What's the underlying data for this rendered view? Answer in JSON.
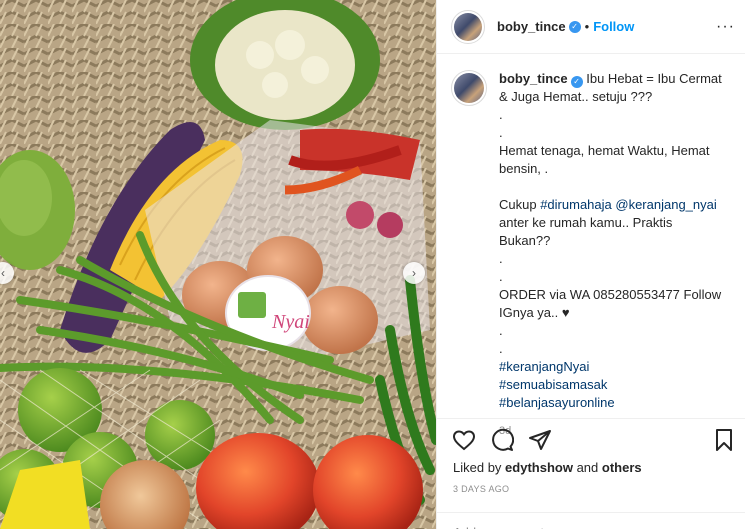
{
  "photo": {
    "alt_icons": [
      "chevron-left-icon",
      "chevron-right-icon"
    ],
    "prev_glyph": "‹",
    "next_glyph": "›",
    "sticker_text": "Nyai"
  },
  "header": {
    "username": "boby_tince",
    "verified_glyph": "✓",
    "separator": "•",
    "follow_label": "Follow",
    "more_glyph": "···"
  },
  "caption": {
    "username": "boby_tince",
    "verified_glyph": "✓",
    "first_line": "Ibu Hebat = Ibu Cermat",
    "second_line": "& Juga Hemat.. setuju ???",
    "dot1": ".",
    "dot2": ".",
    "line3": "Hemat tenaga, hemat Waktu, Hemat",
    "line4": "bensin, .",
    "line5_prefix": "Cukup ",
    "line5_tag": "#dirumahaja",
    "line5_space": " ",
    "line5_mention": "@keranjang_nyai",
    "line6": "anter ke rumah kamu.. Praktis Bukan??",
    "dot3": ".",
    "dot4": ".",
    "line7": "ORDER via WA 085280553477 Follow",
    "line8": "IGnya ya.. ♥",
    "dot5": ".",
    "dot6": ".",
    "tag1": "#keranjangNyai",
    "tag2": "#semuabisamasak",
    "tag3": "#belanjasayuronline",
    "age": "3d"
  },
  "actions": {
    "icons": [
      "heart-icon",
      "comment-icon",
      "share-icon",
      "bookmark-icon"
    ]
  },
  "likes": {
    "prefix": "Liked by ",
    "user": "edythshow",
    "middle": " and ",
    "others": "others"
  },
  "timestamp": "3 DAYS AGO",
  "add_comment": {
    "placeholder": "Add a comment..."
  },
  "colors": {
    "link": "#00376b",
    "follow": "#0095f6",
    "verified": "#3897f0",
    "muted": "#8e8e8e"
  }
}
